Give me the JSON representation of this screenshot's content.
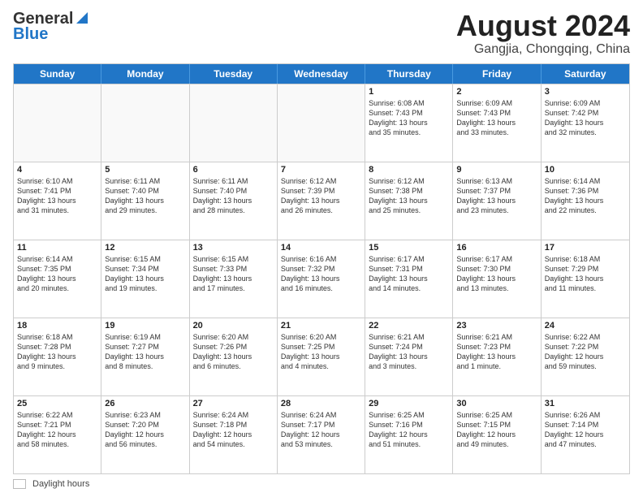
{
  "header": {
    "logo_line1": "General",
    "logo_line2": "Blue",
    "title": "August 2024",
    "location": "Gangjia, Chongqing, China"
  },
  "days": [
    "Sunday",
    "Monday",
    "Tuesday",
    "Wednesday",
    "Thursday",
    "Friday",
    "Saturday"
  ],
  "weeks": [
    [
      {
        "date": "",
        "info": ""
      },
      {
        "date": "",
        "info": ""
      },
      {
        "date": "",
        "info": ""
      },
      {
        "date": "",
        "info": ""
      },
      {
        "date": "1",
        "info": "Sunrise: 6:08 AM\nSunset: 7:43 PM\nDaylight: 13 hours\nand 35 minutes."
      },
      {
        "date": "2",
        "info": "Sunrise: 6:09 AM\nSunset: 7:43 PM\nDaylight: 13 hours\nand 33 minutes."
      },
      {
        "date": "3",
        "info": "Sunrise: 6:09 AM\nSunset: 7:42 PM\nDaylight: 13 hours\nand 32 minutes."
      }
    ],
    [
      {
        "date": "4",
        "info": "Sunrise: 6:10 AM\nSunset: 7:41 PM\nDaylight: 13 hours\nand 31 minutes."
      },
      {
        "date": "5",
        "info": "Sunrise: 6:11 AM\nSunset: 7:40 PM\nDaylight: 13 hours\nand 29 minutes."
      },
      {
        "date": "6",
        "info": "Sunrise: 6:11 AM\nSunset: 7:40 PM\nDaylight: 13 hours\nand 28 minutes."
      },
      {
        "date": "7",
        "info": "Sunrise: 6:12 AM\nSunset: 7:39 PM\nDaylight: 13 hours\nand 26 minutes."
      },
      {
        "date": "8",
        "info": "Sunrise: 6:12 AM\nSunset: 7:38 PM\nDaylight: 13 hours\nand 25 minutes."
      },
      {
        "date": "9",
        "info": "Sunrise: 6:13 AM\nSunset: 7:37 PM\nDaylight: 13 hours\nand 23 minutes."
      },
      {
        "date": "10",
        "info": "Sunrise: 6:14 AM\nSunset: 7:36 PM\nDaylight: 13 hours\nand 22 minutes."
      }
    ],
    [
      {
        "date": "11",
        "info": "Sunrise: 6:14 AM\nSunset: 7:35 PM\nDaylight: 13 hours\nand 20 minutes."
      },
      {
        "date": "12",
        "info": "Sunrise: 6:15 AM\nSunset: 7:34 PM\nDaylight: 13 hours\nand 19 minutes."
      },
      {
        "date": "13",
        "info": "Sunrise: 6:15 AM\nSunset: 7:33 PM\nDaylight: 13 hours\nand 17 minutes."
      },
      {
        "date": "14",
        "info": "Sunrise: 6:16 AM\nSunset: 7:32 PM\nDaylight: 13 hours\nand 16 minutes."
      },
      {
        "date": "15",
        "info": "Sunrise: 6:17 AM\nSunset: 7:31 PM\nDaylight: 13 hours\nand 14 minutes."
      },
      {
        "date": "16",
        "info": "Sunrise: 6:17 AM\nSunset: 7:30 PM\nDaylight: 13 hours\nand 13 minutes."
      },
      {
        "date": "17",
        "info": "Sunrise: 6:18 AM\nSunset: 7:29 PM\nDaylight: 13 hours\nand 11 minutes."
      }
    ],
    [
      {
        "date": "18",
        "info": "Sunrise: 6:18 AM\nSunset: 7:28 PM\nDaylight: 13 hours\nand 9 minutes."
      },
      {
        "date": "19",
        "info": "Sunrise: 6:19 AM\nSunset: 7:27 PM\nDaylight: 13 hours\nand 8 minutes."
      },
      {
        "date": "20",
        "info": "Sunrise: 6:20 AM\nSunset: 7:26 PM\nDaylight: 13 hours\nand 6 minutes."
      },
      {
        "date": "21",
        "info": "Sunrise: 6:20 AM\nSunset: 7:25 PM\nDaylight: 13 hours\nand 4 minutes."
      },
      {
        "date": "22",
        "info": "Sunrise: 6:21 AM\nSunset: 7:24 PM\nDaylight: 13 hours\nand 3 minutes."
      },
      {
        "date": "23",
        "info": "Sunrise: 6:21 AM\nSunset: 7:23 PM\nDaylight: 13 hours\nand 1 minute."
      },
      {
        "date": "24",
        "info": "Sunrise: 6:22 AM\nSunset: 7:22 PM\nDaylight: 12 hours\nand 59 minutes."
      }
    ],
    [
      {
        "date": "25",
        "info": "Sunrise: 6:22 AM\nSunset: 7:21 PM\nDaylight: 12 hours\nand 58 minutes."
      },
      {
        "date": "26",
        "info": "Sunrise: 6:23 AM\nSunset: 7:20 PM\nDaylight: 12 hours\nand 56 minutes."
      },
      {
        "date": "27",
        "info": "Sunrise: 6:24 AM\nSunset: 7:18 PM\nDaylight: 12 hours\nand 54 minutes."
      },
      {
        "date": "28",
        "info": "Sunrise: 6:24 AM\nSunset: 7:17 PM\nDaylight: 12 hours\nand 53 minutes."
      },
      {
        "date": "29",
        "info": "Sunrise: 6:25 AM\nSunset: 7:16 PM\nDaylight: 12 hours\nand 51 minutes."
      },
      {
        "date": "30",
        "info": "Sunrise: 6:25 AM\nSunset: 7:15 PM\nDaylight: 12 hours\nand 49 minutes."
      },
      {
        "date": "31",
        "info": "Sunrise: 6:26 AM\nSunset: 7:14 PM\nDaylight: 12 hours\nand 47 minutes."
      }
    ]
  ],
  "footer": {
    "daylight_label": "Daylight hours"
  }
}
